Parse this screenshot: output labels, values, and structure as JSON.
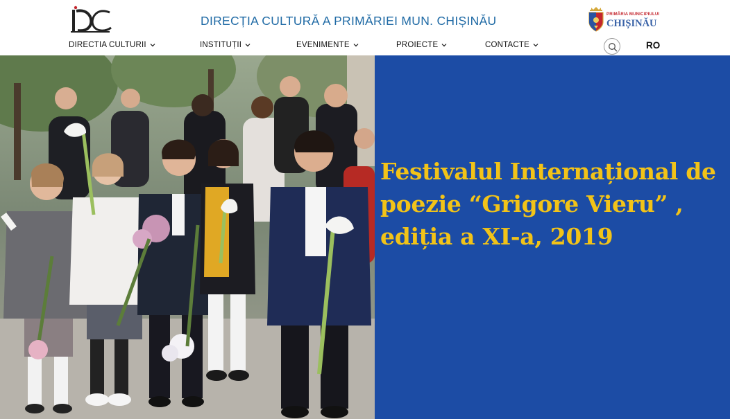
{
  "header": {
    "logo_text": "DC",
    "site_title": "DIRECȚIA CULTURĂ A PRIMĂRIEI MUN. CHIȘINĂU",
    "city_logo": {
      "small_text": "PRIMĂRIA MUNICIPIULUI",
      "big_text": "CHIȘINĂU"
    }
  },
  "nav": {
    "items": [
      {
        "label": "DIRECTIA CULTURII"
      },
      {
        "label": "INSTITUȚII"
      },
      {
        "label": "EVENIMENTE"
      },
      {
        "label": "PROIECTE"
      },
      {
        "label": "CONTACTE"
      }
    ],
    "search_icon": "search-icon",
    "language": "RO"
  },
  "hero": {
    "headline": "Festivalul Internațional de poezie “Grigore Vieru” , ediția a XI-a, 2019",
    "photo_subject": "group-photo",
    "colors": {
      "panel": "#1c4ca5",
      "headline": "#f2c318",
      "title": "#1f6aa5"
    }
  }
}
